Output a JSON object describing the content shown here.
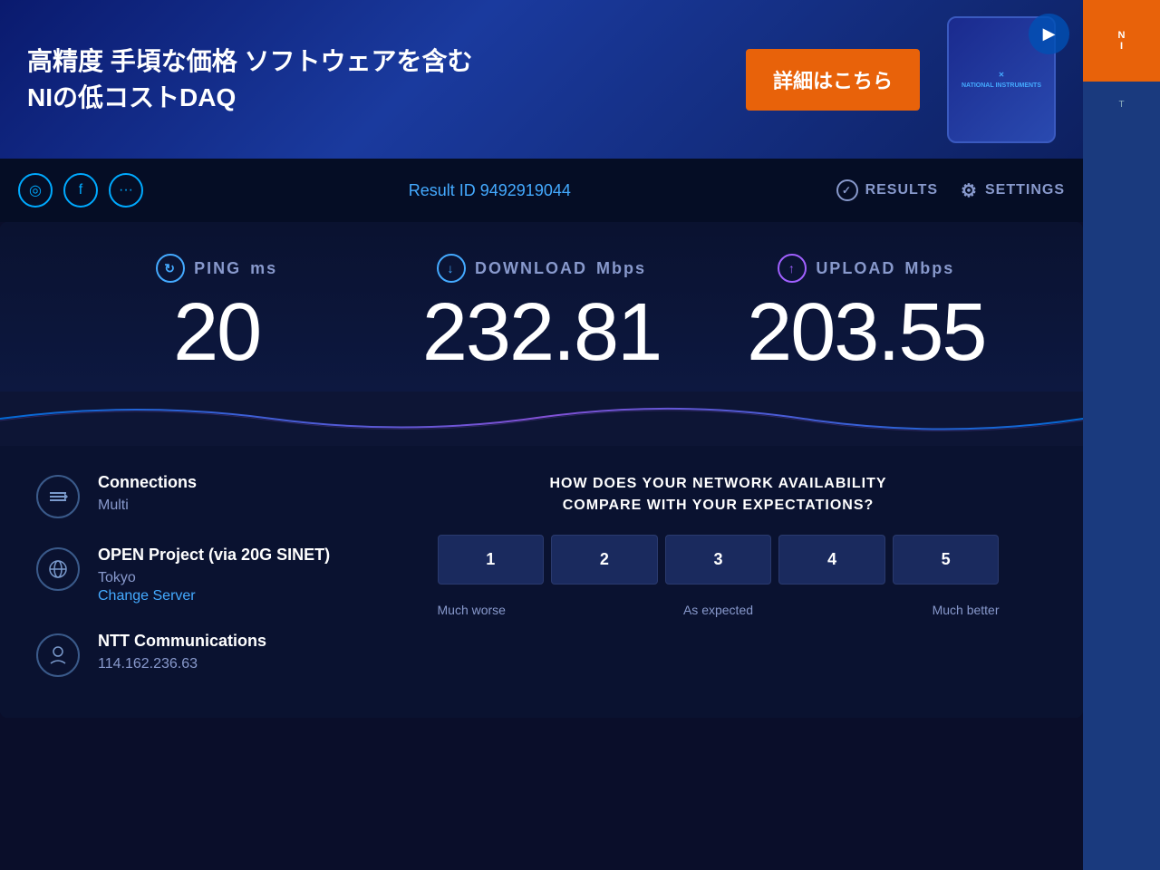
{
  "ad": {
    "text_line1": "高精度 手頃な価格 ソフトウェアを含む",
    "text_line2": "NIの低コストDAQ",
    "button_label": "詳細はこちら",
    "device_brand": "NATIONAL INSTRUMENTS",
    "play_icon": "▶"
  },
  "header": {
    "result_label": "Result ID",
    "result_id": "9492919044",
    "nav": [
      {
        "id": "results",
        "icon": "✓",
        "label": "RESULTS"
      },
      {
        "id": "settings",
        "icon": "⚙",
        "label": "SETTINGS"
      }
    ]
  },
  "social_icons": [
    {
      "id": "circle-icon",
      "symbol": "◯"
    },
    {
      "id": "facebook-icon",
      "symbol": "f"
    },
    {
      "id": "more-icon",
      "symbol": "···"
    }
  ],
  "metrics": {
    "ping": {
      "label": "PING",
      "unit": "ms",
      "value": "20",
      "icon": "↻",
      "icon_type": "ping"
    },
    "download": {
      "label": "DOWNLOAD",
      "unit": "Mbps",
      "value": "232.81",
      "icon": "↓",
      "icon_type": "download"
    },
    "upload": {
      "label": "UPLOAD",
      "unit": "Mbps",
      "value": "203.55",
      "icon": "↑",
      "icon_type": "upload"
    }
  },
  "info": {
    "connections": {
      "title": "Connections",
      "value": "Multi"
    },
    "server": {
      "title": "OPEN Project (via 20G SINET)",
      "location": "Tokyo",
      "change_label": "Change Server"
    },
    "isp": {
      "title": "NTT Communications",
      "ip": "114.162.236.63"
    }
  },
  "survey": {
    "question": "HOW DOES YOUR NETWORK AVAILABILITY\nCOMPARE WITH YOUR EXPECTATIONS?",
    "buttons": [
      "1",
      "2",
      "3",
      "4",
      "5"
    ],
    "label_left": "Much worse",
    "label_center": "As expected",
    "label_right": "Much better"
  }
}
